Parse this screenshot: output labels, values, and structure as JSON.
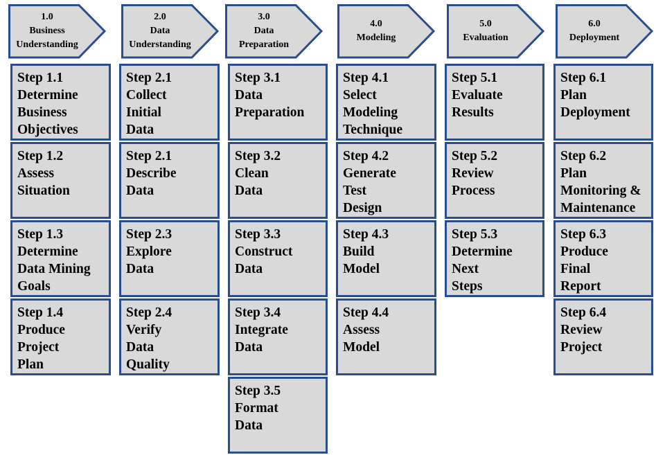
{
  "colors": {
    "border": "#2a4d8f",
    "fill": "#d9d9d9"
  },
  "phases": [
    {
      "number": "1.0",
      "title": "Business\nUnderstanding",
      "steps": [
        "Step 1.1\nDetermine\nBusiness\nObjectives",
        "Step 1.2\nAssess\nSituation",
        "Step 1.3\nDetermine\nData Mining\nGoals",
        "Step 1.4\nProduce\nProject\nPlan"
      ]
    },
    {
      "number": "2.0",
      "title": "Data\nUnderstanding",
      "steps": [
        "Step 2.1\nCollect\nInitial\nData",
        "Step 2.1\nDescribe\nData",
        "Step 2.3\nExplore\nData",
        "Step 2.4\nVerify\nData\nQuality"
      ]
    },
    {
      "number": "3.0",
      "title": "Data\nPreparation",
      "steps": [
        "Step 3.1\nData\nPreparation",
        "Step 3.2\nClean\nData",
        "Step 3.3\nConstruct\nData",
        "Step 3.4\nIntegrate\nData",
        "Step 3.5\nFormat\nData"
      ]
    },
    {
      "number": "4.0",
      "title": "Modeling",
      "steps": [
        "Step 4.1\nSelect\nModeling\nTechnique",
        "Step 4.2\nGenerate\nTest\nDesign",
        "Step 4.3\nBuild\nModel",
        "Step 4.4\nAssess\nModel"
      ]
    },
    {
      "number": "5.0",
      "title": "Evaluation",
      "steps": [
        "Step 5.1\nEvaluate\nResults",
        "Step 5.2\nReview\nProcess",
        "Step 5.3\nDetermine\nNext\nSteps"
      ]
    },
    {
      "number": "6.0",
      "title": "Deployment",
      "steps": [
        "Step 6.1\nPlan\nDeployment",
        "Step 6.2\nPlan\nMonitoring &\nMaintenance",
        "Step 6.3\nProduce\nFinal\nReport",
        "Step 6.4\nReview\nProject"
      ]
    }
  ]
}
